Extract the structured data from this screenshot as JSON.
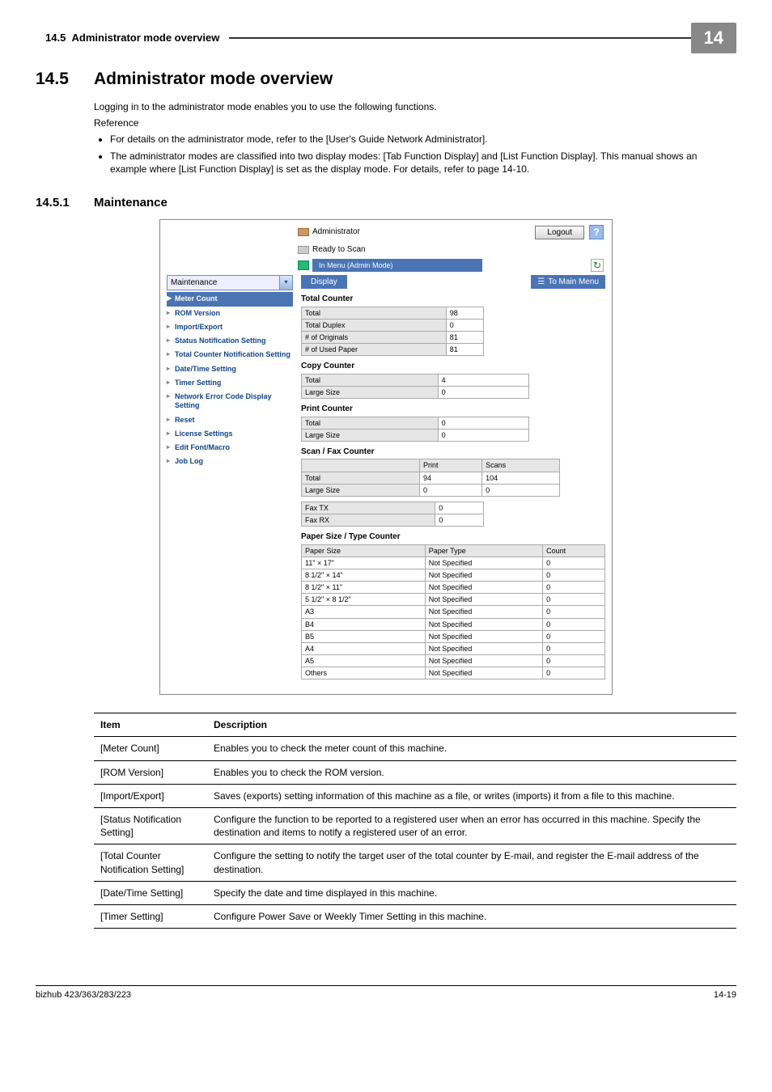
{
  "header": {
    "section_no": "14.5",
    "section_label": "Administrator mode overview",
    "chapter_no": "14"
  },
  "title": {
    "num": "14.5",
    "text": "Administrator mode overview"
  },
  "intro": {
    "p1": "Logging in to the administrator mode enables you to use the following functions.",
    "ref_label": "Reference",
    "b1": "For details on the administrator mode, refer to the [User's Guide Network Administrator].",
    "b2": "The administrator modes are classified into two display modes: [Tab Function Display] and [List Function Display]. This manual shows an example where [List Function Display] is set as the display mode. For details, refer to page 14-10."
  },
  "subsection": {
    "num": "14.5.1",
    "text": "Maintenance"
  },
  "shot": {
    "administrator": "Administrator",
    "logout": "Logout",
    "help": "?",
    "ready": "Ready to Scan",
    "mode": "In Menu (Admin Mode)",
    "refresh": "↻",
    "maintenance": "Maintenance",
    "display": "Display",
    "to_main": "To Main Menu",
    "nav": {
      "meter": "Meter Count",
      "rom": "ROM Version",
      "impexp": "Import/Export",
      "status": "Status Notification Setting",
      "totalcnt": "Total Counter Notification Setting",
      "datetime": "Date/Time Setting",
      "timer": "Timer Setting",
      "neterr": "Network Error Code Display Setting",
      "reset": "Reset",
      "license": "License Settings",
      "editfont": "Edit Font/Macro",
      "joblog": "Job Log"
    },
    "sections": {
      "total_counter": "Total Counter",
      "copy_counter": "Copy Counter",
      "print_counter": "Print Counter",
      "scanfax_counter": "Scan / Fax Counter",
      "papertype": "Paper Size / Type Counter"
    },
    "labels": {
      "total": "Total",
      "total_duplex": "Total Duplex",
      "originals": "# of Originals",
      "used_paper": "# of Used Paper",
      "large": "Large Size",
      "print": "Print",
      "scans": "Scans",
      "fax_tx": "Fax TX",
      "fax_rx": "Fax RX",
      "paper_size": "Paper Size",
      "paper_type": "Paper Type",
      "count": "Count",
      "not_specified": "Not Specified"
    },
    "values": {
      "tc_total": "98",
      "tc_duplex": "0",
      "tc_orig": "81",
      "tc_used": "81",
      "cc_total": "4",
      "cc_large": "0",
      "pc_total": "0",
      "pc_large": "0",
      "sf_total_print": "94",
      "sf_total_scans": "104",
      "sf_large_print": "0",
      "sf_large_scans": "0",
      "fax_tx": "0",
      "fax_rx": "0"
    },
    "paper_rows": [
      {
        "size": "11\" × 17\"",
        "count": "0"
      },
      {
        "size": "8 1/2\" × 14\"",
        "count": "0"
      },
      {
        "size": "8 1/2\" × 11\"",
        "count": "0"
      },
      {
        "size": "5 1/2\" × 8 1/2\"",
        "count": "0"
      },
      {
        "size": "A3",
        "count": "0"
      },
      {
        "size": "B4",
        "count": "0"
      },
      {
        "size": "B5",
        "count": "0"
      },
      {
        "size": "A4",
        "count": "0"
      },
      {
        "size": "A5",
        "count": "0"
      },
      {
        "size": "Others",
        "count": "0"
      }
    ]
  },
  "desc_table": {
    "h_item": "Item",
    "h_desc": "Description",
    "rows": [
      {
        "item": "[Meter Count]",
        "desc": "Enables you to check the meter count of this machine."
      },
      {
        "item": "[ROM Version]",
        "desc": "Enables you to check the ROM version."
      },
      {
        "item": "[Import/Export]",
        "desc": "Saves (exports) setting information of this machine as a file, or writes (imports) it from a file to this machine."
      },
      {
        "item": "[Status Notification Setting]",
        "desc": "Configure the function to be reported to a registered user when an error has occurred in this machine. Specify the destination and items to notify a registered user of an error."
      },
      {
        "item": "[Total Counter Notification Setting]",
        "desc": "Configure the setting to notify the target user of the total counter by E-mail, and register the E-mail address of the destination."
      },
      {
        "item": "[Date/Time Setting]",
        "desc": "Specify the date and time displayed in this machine."
      },
      {
        "item": "[Timer Setting]",
        "desc": "Configure Power Save or Weekly Timer Setting in this machine."
      }
    ]
  },
  "footer": {
    "left": "bizhub 423/363/283/223",
    "right": "14-19"
  }
}
